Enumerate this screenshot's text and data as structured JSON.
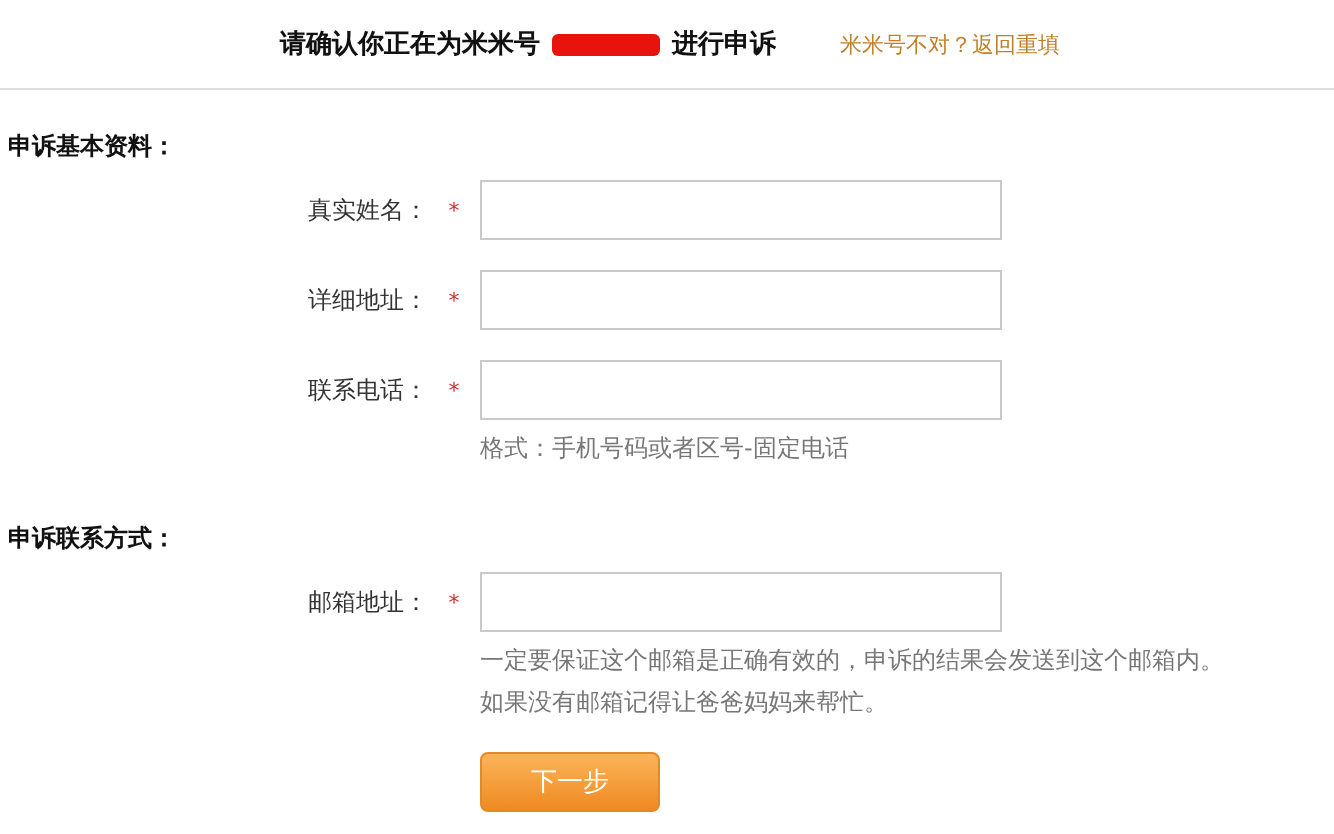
{
  "header": {
    "title_before": "请确认你正在为米米号",
    "title_after": "进行申诉",
    "redacted": true,
    "link": "米米号不对？返回重填"
  },
  "sections": [
    {
      "heading": "申诉基本资料：",
      "fields": [
        {
          "label": "真实姓名：",
          "required_mark": "*"
        },
        {
          "label": "详细地址：",
          "required_mark": "*"
        },
        {
          "label": "联系电话：",
          "required_mark": "*",
          "hint": [
            "格式：手机号码或者区号-固定电话"
          ]
        }
      ]
    },
    {
      "heading": "申诉联系方式：",
      "fields": [
        {
          "label": "邮箱地址：",
          "required_mark": "*",
          "hint": [
            "一定要保证这个邮箱是正确有效的，申诉的结果会发送到这个邮箱内。",
            "如果没有邮箱记得让爸爸妈妈来帮忙。"
          ]
        }
      ]
    }
  ],
  "button": "下一步"
}
